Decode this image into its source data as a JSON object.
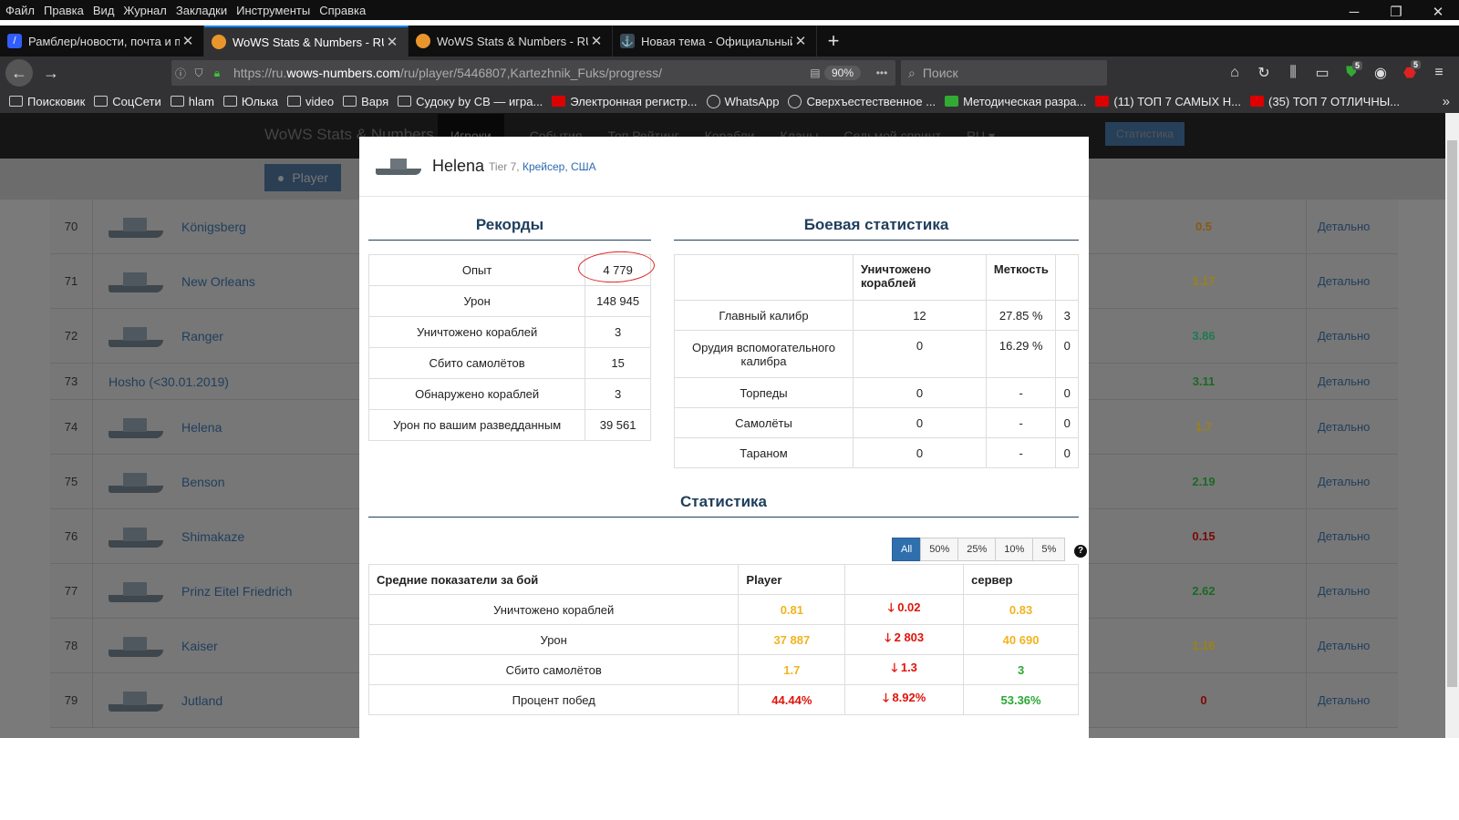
{
  "menubar": [
    "Файл",
    "Правка",
    "Вид",
    "Журнал",
    "Закладки",
    "Инструменты",
    "Справка"
  ],
  "window_controls": [
    "─",
    "❐",
    "✕"
  ],
  "tabs": [
    {
      "title": "Рамблер/новости, почта и по",
      "favicon": "rambler-icon",
      "color": "#315efb",
      "glyph": "/"
    },
    {
      "title": "WoWS Stats & Numbers - RU -",
      "favicon": "wows-numbers-icon",
      "color": "#e8962c",
      "glyph": ""
    },
    {
      "title": "WoWS Stats & Numbers - RU -",
      "favicon": "wows-numbers-icon",
      "color": "#e8962c",
      "glyph": ""
    },
    {
      "title": "Новая тема - Официальный ф",
      "favicon": "wows-forum-icon",
      "color": "#3a4a56",
      "glyph": "⚓"
    }
  ],
  "tab_close": "✕",
  "new_tab": "+",
  "address": {
    "prefix": "https://ru.",
    "domain": "wows-numbers.com",
    "path": "/ru/player/5446807,Kartezhnik_Fuks/progress/",
    "zoom": "90%",
    "menu": "•••"
  },
  "search": {
    "placeholder": "Поиск"
  },
  "toolbar_badges": {
    "shield": "5",
    "adblock": "5"
  },
  "bookmarks": [
    "Поисковик",
    "СоцСети",
    "hlam",
    "Юлька",
    "video",
    "Варя",
    "Судоку by CB — игра...",
    "Электронная регистр...",
    "WhatsApp",
    "Сверхъестественное ...",
    "Методическая разра...",
    "(11) ТОП 7 САМЫХ Н...",
    "(35) ТОП 7 ОТЛИЧНЫ..."
  ],
  "site": {
    "brand": "WoWS Stats & Numbers",
    "nav": [
      "Игроки",
      "События",
      "Топ Рейтинг",
      "Корабли",
      "Кланы",
      "Седьмой спринт",
      "RU ▾"
    ],
    "stat_button": "Статистика",
    "player_button": "Player"
  },
  "ships_table": [
    {
      "num": "70",
      "name": "Königsberg",
      "value": "0.5",
      "color": "#8a5a10",
      "detail": "Детально"
    },
    {
      "num": "71",
      "name": "New Orleans",
      "value": "1.17",
      "color": "#9a8214",
      "detail": "Детально"
    },
    {
      "num": "72",
      "name": "Ranger",
      "value": "3.86",
      "color": "#1e7a52",
      "detail": "Детально"
    },
    {
      "num": "73",
      "name": "Hosho (<30.01.2019)",
      "value": "3.11",
      "color": "#1a6a24",
      "detail": "Детально"
    },
    {
      "num": "74",
      "name": "Helena",
      "value": "1.7",
      "color": "#9a8214",
      "detail": "Детально"
    },
    {
      "num": "75",
      "name": "Benson",
      "value": "2.19",
      "color": "#1a6a24",
      "detail": "Детально"
    },
    {
      "num": "76",
      "name": "Shimakaze",
      "value": "0.15",
      "color": "#7a0a06",
      "detail": "Детально"
    },
    {
      "num": "77",
      "name": "Prinz Eitel Friedrich",
      "value": "2.62",
      "color": "#1a6a24",
      "detail": "Детально"
    },
    {
      "num": "78",
      "name": "Kaiser",
      "value": "1.16",
      "color": "#9a8214",
      "detail": "Детально"
    },
    {
      "num": "79",
      "name": "Jutland",
      "value": "0",
      "color": "#7a0a06",
      "detail": "Детально"
    }
  ],
  "modal": {
    "ship": "Helena",
    "tier": "Tier 7,",
    "class_nation": "Крейсер, США",
    "records_title": "Рекорды",
    "battle_title": "Боевая статистика",
    "stats_title": "Статистика",
    "records": [
      {
        "k": "Опыт",
        "v": "4 779"
      },
      {
        "k": "Урон",
        "v": "148 945"
      },
      {
        "k": "Уничтожено кораблей",
        "v": "3"
      },
      {
        "k": "Сбито самолётов",
        "v": "15"
      },
      {
        "k": "Обнаружено кораблей",
        "v": "3"
      },
      {
        "k": "Урон по вашим разведданным",
        "v": "39 561"
      }
    ],
    "battle_headers": [
      "",
      "Уничтожено кораблей",
      "Меткость",
      ""
    ],
    "battle": [
      {
        "w": "Главный калибр",
        "k": "12",
        "a": "27.85 %",
        "x": "3"
      },
      {
        "w": "Орудия вспомогательного калибра",
        "k": "0",
        "a": "16.29 %",
        "x": "0"
      },
      {
        "w": "Торпеды",
        "k": "0",
        "a": "-",
        "x": "0"
      },
      {
        "w": "Самолёты",
        "k": "0",
        "a": "-",
        "x": "0"
      },
      {
        "w": "Тараном",
        "k": "0",
        "a": "-",
        "x": "0"
      }
    ],
    "filters": [
      "All",
      "50%",
      "25%",
      "10%",
      "5%"
    ],
    "help": "?",
    "avg_headers": [
      "Средние показатели за бой",
      "Player",
      "",
      "сервер"
    ],
    "avg": [
      {
        "k": "Уничтожено кораблей",
        "p": "0.81",
        "pc": "yel",
        "d": "0.02",
        "s": "0.83",
        "sc": "yel"
      },
      {
        "k": "Урон",
        "p": "37 887",
        "pc": "yel",
        "d": "2 803",
        "s": "40 690",
        "sc": "yel"
      },
      {
        "k": "Сбито самолётов",
        "p": "1.7",
        "pc": "yel",
        "d": "1.3",
        "s": "3",
        "sc": "grn"
      },
      {
        "k": "Процент побед",
        "p": "44.44%",
        "pc": "red",
        "d": "8.92%",
        "s": "53.36%",
        "sc": "grn"
      }
    ]
  }
}
